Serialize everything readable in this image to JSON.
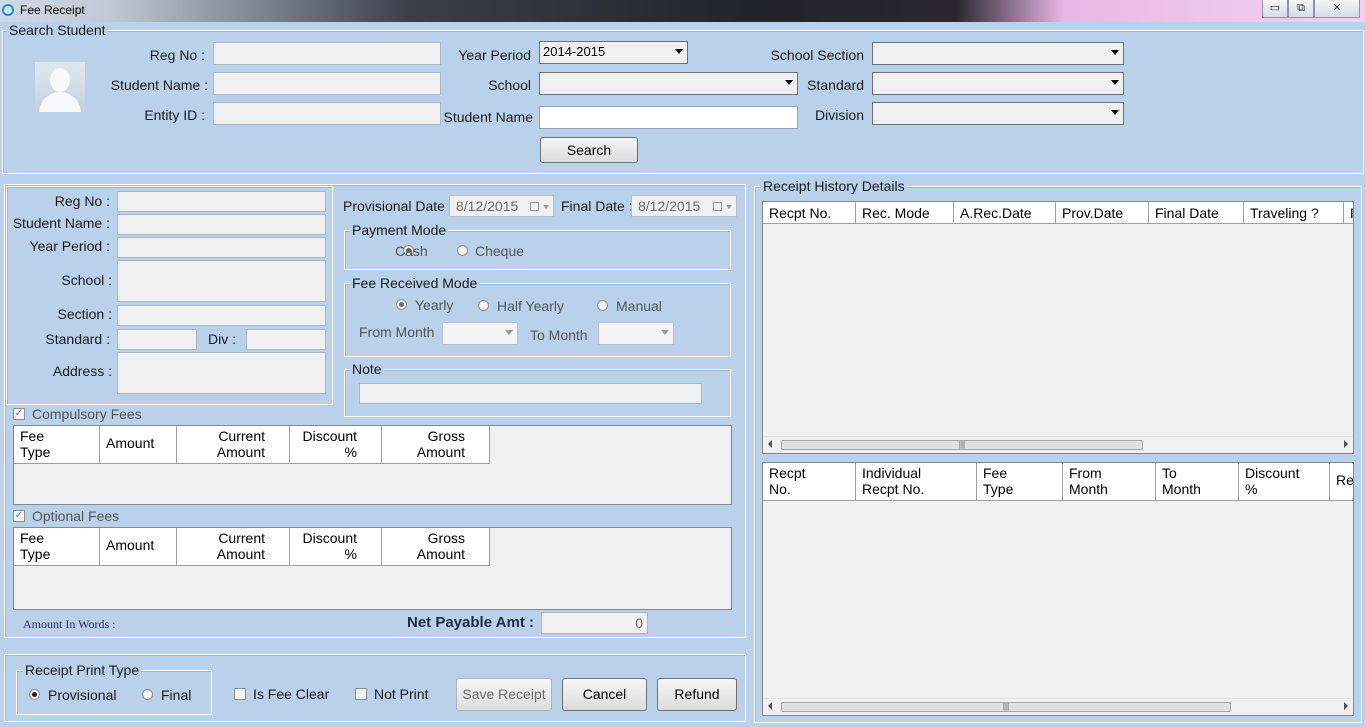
{
  "window": {
    "title": "Fee Receipt",
    "minimize": "▭",
    "restore": "⧉",
    "close": "✕"
  },
  "search_student": {
    "group_label": "Search Student",
    "reg_no_label": "Reg No :",
    "student_name_label": "Student Name :",
    "entity_id_label": "Entity ID :",
    "year_period_label": "Year Period",
    "year_period_value": "2014-2015",
    "school_label": "School",
    "student_name2_label": "Student Name",
    "school_section_label": "School Section",
    "standard_label": "Standard",
    "division_label": "Division",
    "search_button": "Search"
  },
  "student_details": {
    "reg_no_label": "Reg No :",
    "student_name_label": "Student Name :",
    "year_period_label": "Year Period :",
    "school_label": "School :",
    "section_label": "Section :",
    "standard_label": "Standard :",
    "div_label": "Div :",
    "address_label": "Address :"
  },
  "dates": {
    "provisional_label": "Provisional Date :",
    "provisional_value": "8/12/2015",
    "final_label": "Final Date :",
    "final_value": "8/12/2015"
  },
  "payment_mode": {
    "label": "Payment Mode",
    "cash": "Cash",
    "cheque": "Cheque"
  },
  "fee_received_mode": {
    "label": "Fee Received Mode",
    "yearly": "Yearly",
    "half_yearly": "Half Yearly",
    "manual": "Manual",
    "from_month_label": "From Month",
    "to_month_label": "To Month"
  },
  "note": {
    "label": "Note"
  },
  "compulsory_fees": {
    "label": "Compulsory Fees",
    "check": "✓",
    "columns": [
      [
        "Fee",
        "Type"
      ],
      [
        "Amount",
        ""
      ],
      [
        "Current",
        "Amount"
      ],
      [
        "Discount",
        "%"
      ],
      [
        "Gross",
        "Amount"
      ]
    ]
  },
  "optional_fees": {
    "label": "Optional Fees",
    "check": "✓",
    "columns": [
      [
        "Fee",
        "Type"
      ],
      [
        "Amount",
        ""
      ],
      [
        "Current",
        "Amount"
      ],
      [
        "Discount",
        "%"
      ],
      [
        "Gross",
        "Amount"
      ]
    ]
  },
  "totals": {
    "amount_in_words_label": "Amount In Words :",
    "net_payable_label": "Net Payable Amt :",
    "net_payable_value": "0"
  },
  "receipt_print": {
    "label": "Receipt Print Type",
    "provisional": "Provisional",
    "final": "Final",
    "is_fee_clear": "Is Fee Clear",
    "not_print": "Not Print",
    "save_button": "Save Receipt",
    "cancel_button": "Cancel",
    "refund_button": "Refund"
  },
  "history": {
    "label": "Receipt History Details",
    "columns": [
      "Recpt No.",
      "Rec. Mode",
      "A.Rec.Date",
      "Prov.Date",
      "Final Date",
      "Traveling ?",
      "F"
    ],
    "detail_columns": [
      [
        "Recpt",
        "No."
      ],
      [
        "Individual",
        "Recpt No."
      ],
      [
        "Fee",
        "Type"
      ],
      [
        "From",
        "Month"
      ],
      [
        "To",
        "Month"
      ],
      [
        "Discount",
        "%"
      ],
      [
        "Re",
        ""
      ]
    ],
    "scroll_grip": "|||"
  }
}
